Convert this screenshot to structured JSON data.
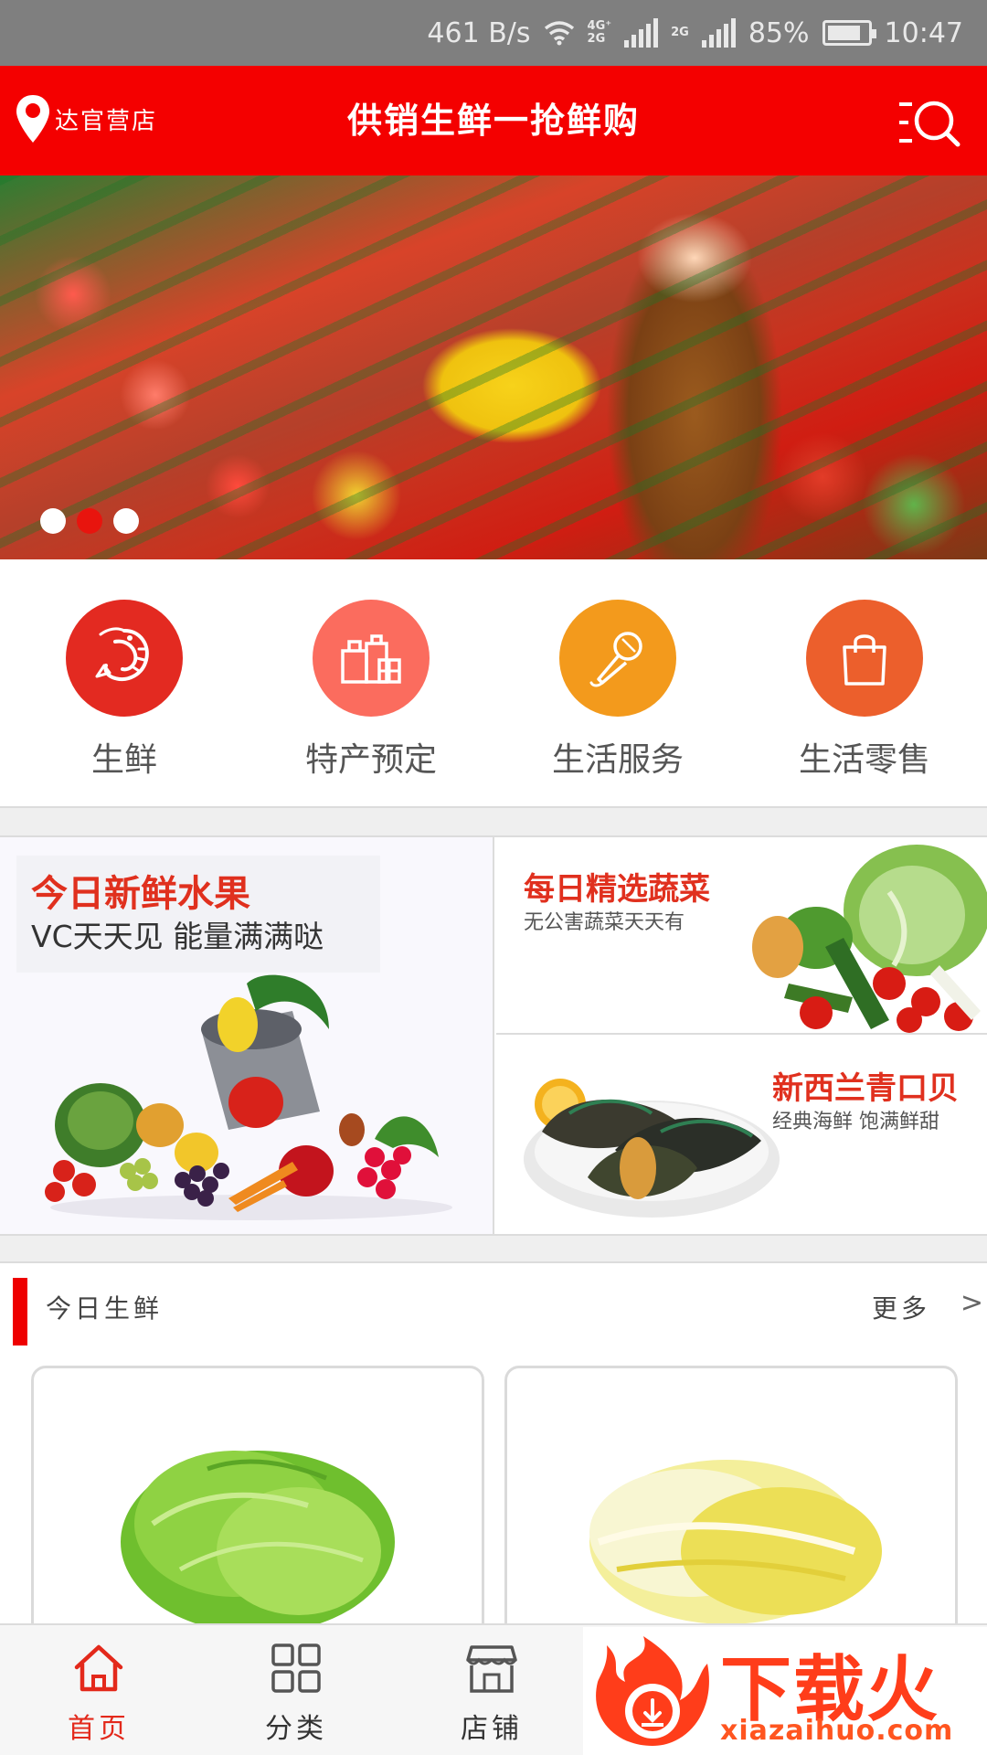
{
  "status_bar": {
    "speed": "461 B/s",
    "network_top": "4G⁺",
    "network_bottom": "2G",
    "network2": "2G",
    "battery_pct": "85%",
    "battery_level": 0.85,
    "time": "10:47"
  },
  "header": {
    "location": "达官营店",
    "title": "供销生鲜一抢鲜购",
    "accent_color": "#f40000"
  },
  "banner": {
    "slide_count": 3,
    "active_index": 1
  },
  "categories": [
    {
      "label": "生鲜",
      "icon": "shrimp-icon",
      "color": "#e32a21"
    },
    {
      "label": "特产预定",
      "icon": "shopping-bags-icon",
      "color": "#fb6c5e"
    },
    {
      "label": "生活服务",
      "icon": "microphone-icon",
      "color": "#f39a1c"
    },
    {
      "label": "生活零售",
      "icon": "shopping-bag-icon",
      "color": "#ec5f2c"
    }
  ],
  "promos": {
    "fruit": {
      "title": "今日新鲜水果",
      "subtitle": "VC天天见 能量满满哒"
    },
    "vegetables": {
      "title": "每日精选蔬菜",
      "subtitle": "无公害蔬菜天天有"
    },
    "mussels": {
      "title": "新西兰青口贝",
      "subtitle": "经典海鲜 饱满鲜甜"
    }
  },
  "section": {
    "title": "今日生鲜",
    "more": "更多",
    "arrow": ">"
  },
  "products": [
    {
      "image": "lettuce"
    },
    {
      "image": "chinese-cabbage"
    }
  ],
  "tabbar": {
    "tabs": [
      {
        "label": "首页",
        "icon": "home-icon",
        "active": true
      },
      {
        "label": "分类",
        "icon": "grid-icon",
        "active": false
      },
      {
        "label": "店铺",
        "icon": "store-icon",
        "active": false
      }
    ]
  },
  "watermark": {
    "text": "下载火",
    "url": "xiazaihuo.com"
  }
}
